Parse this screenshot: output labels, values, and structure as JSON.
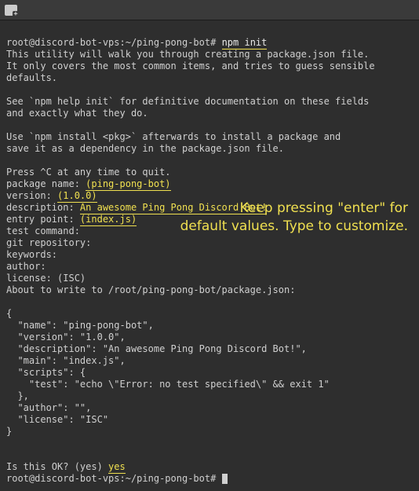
{
  "titlebar": {
    "icon_name": "new-tab-icon"
  },
  "prompt": {
    "userhost": "root@discord-bot-vps",
    "sep1": ":",
    "path": "~/ping-pong-bot",
    "sigil": "#"
  },
  "command": "npm init",
  "output": {
    "l1": "This utility will walk you through creating a package.json file.",
    "l2": "It only covers the most common items, and tries to guess sensible defaults.",
    "l3": "",
    "l4": "See `npm help init` for definitive documentation on these fields",
    "l5": "and exactly what they do.",
    "l6": "",
    "l7": "Use `npm install <pkg>` afterwards to install a package and",
    "l8": "save it as a dependency in the package.json file.",
    "l9": "",
    "l10": "Press ^C at any time to quit."
  },
  "fields": {
    "package_name_label": "package name: ",
    "package_name_value": "(ping-pong-bot)",
    "version_label": "version: ",
    "version_value": "(1.0.0)",
    "description_label": "description: ",
    "description_value": "An awesome Ping Pong Discord Bot!",
    "entry_point_label": "entry point: ",
    "entry_point_value": "(index.js)",
    "test_command_label": "test command:",
    "git_repository_label": "git repository:",
    "keywords_label": "keywords:",
    "author_label": "author:",
    "license_label": "license: (ISC)"
  },
  "about": "About to write to /root/ping-pong-bot/package.json:",
  "json_preview": {
    "open": "{",
    "name": "  \"name\": \"ping-pong-bot\",",
    "version": "  \"version\": \"1.0.0\",",
    "desc": "  \"description\": \"An awesome Ping Pong Discord Bot!\",",
    "main": "  \"main\": \"index.js\",",
    "scripts_open": "  \"scripts\": {",
    "test": "    \"test\": \"echo \\\"Error: no test specified\\\" && exit 1\"",
    "scripts_close": "  },",
    "author": "  \"author\": \"\",",
    "license": "  \"license\": \"ISC\"",
    "close": "}"
  },
  "confirm": {
    "label": "Is this OK? (yes) ",
    "value": "yes"
  },
  "annotation": {
    "line1": "Keep pressing \"enter\" for",
    "line2": "default values. Type to customize."
  }
}
